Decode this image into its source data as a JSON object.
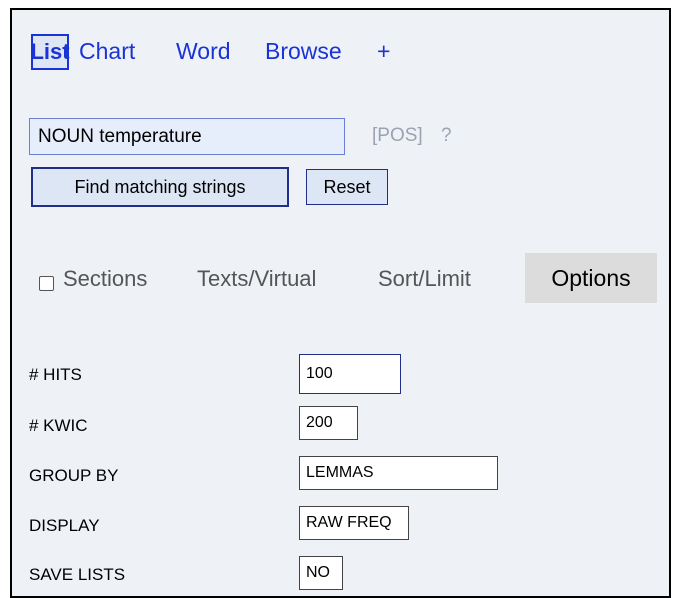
{
  "nav": {
    "tabs": [
      {
        "label": "List",
        "active": true
      },
      {
        "label": "Chart"
      },
      {
        "label": "Word"
      },
      {
        "label": "Browse"
      },
      {
        "label": "+"
      }
    ]
  },
  "search": {
    "value": "NOUN temperature",
    "pos_hint": "[POS]",
    "help": "?",
    "find_label": "Find matching strings",
    "reset_label": "Reset"
  },
  "subtabs": {
    "sections": "Sections",
    "texts": "Texts/Virtual",
    "sort": "Sort/Limit",
    "options": "Options"
  },
  "options": {
    "hits_label": "# HITS",
    "hits_value": "100",
    "kwic_label": "# KWIC",
    "kwic_value": "200",
    "group_label": "GROUP BY",
    "group_value": "LEMMAS",
    "display_label": "DISPLAY",
    "display_value": "RAW FREQ",
    "save_label": "SAVE LISTS",
    "save_value": "NO"
  },
  "colors": {
    "link": "#1a33d6",
    "panel_bg": "#eef2f7",
    "button_bg": "#dde6f4",
    "options_tab_bg": "#dcdcdc"
  }
}
